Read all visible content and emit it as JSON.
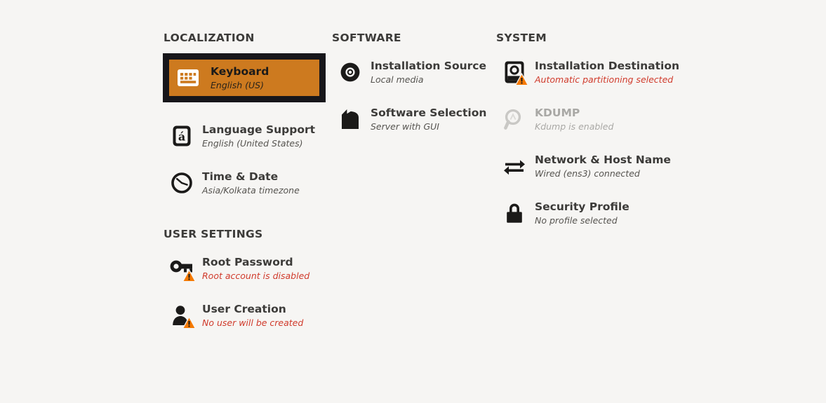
{
  "window": {
    "background_color": "#f6f5f3",
    "selection_color": "#cd7a1f",
    "selection_border_color": "#17161a",
    "warning_text_color": "#d03a2b",
    "disabled_color": "#a9a8a5"
  },
  "columns": {
    "localization": {
      "title": "LOCALIZATION",
      "items": [
        {
          "icon": "keyboard-icon",
          "title": "Keyboard",
          "status": "English (US)",
          "selected": true,
          "warning": false,
          "disabled": false
        },
        {
          "icon": "language-support-icon",
          "title": "Language Support",
          "status": "English (United States)",
          "selected": false,
          "warning": false,
          "disabled": false
        },
        {
          "icon": "clock-icon",
          "title": "Time & Date",
          "status": "Asia/Kolkata timezone",
          "selected": false,
          "warning": false,
          "disabled": false
        }
      ]
    },
    "software": {
      "title": "SOFTWARE",
      "items": [
        {
          "icon": "optical-disc-icon",
          "title": "Installation Source",
          "status": "Local media",
          "selected": false,
          "warning": false,
          "disabled": false
        },
        {
          "icon": "package-icon",
          "title": "Software Selection",
          "status": "Server with GUI",
          "selected": false,
          "warning": false,
          "disabled": false
        }
      ]
    },
    "system": {
      "title": "SYSTEM",
      "items": [
        {
          "icon": "hard-drive-icon",
          "title": "Installation Destination",
          "status": "Automatic partitioning selected",
          "selected": false,
          "warning": true,
          "disabled": false
        },
        {
          "icon": "kdump-magnifier-icon",
          "title": "KDUMP",
          "status": "Kdump is enabled",
          "selected": false,
          "warning": false,
          "disabled": true
        },
        {
          "icon": "network-arrows-icon",
          "title": "Network & Host Name",
          "status": "Wired (ens3) connected",
          "selected": false,
          "warning": false,
          "disabled": false
        },
        {
          "icon": "lock-icon",
          "title": "Security Profile",
          "status": "No profile selected",
          "selected": false,
          "warning": false,
          "disabled": false
        }
      ]
    },
    "user_settings": {
      "title": "USER SETTINGS",
      "items": [
        {
          "icon": "key-icon",
          "title": "Root Password",
          "status": "Root account is disabled",
          "selected": false,
          "warning": true,
          "disabled": false
        },
        {
          "icon": "user-icon",
          "title": "User Creation",
          "status": "No user will be created",
          "selected": false,
          "warning": true,
          "disabled": false
        }
      ]
    }
  }
}
